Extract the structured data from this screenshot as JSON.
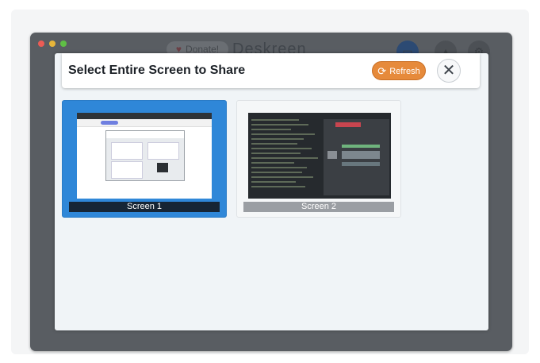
{
  "background_app": {
    "donate_label": "Donate!",
    "app_name": "Deskreen"
  },
  "dialog": {
    "title": "Select Entire Screen to Share",
    "refresh_label": "Refresh",
    "close_symbol": "✕"
  },
  "screens": [
    {
      "label": "Screen 1",
      "selected": true
    },
    {
      "label": "Screen 2",
      "selected": false
    }
  ],
  "icons": {
    "refresh": "refresh-icon",
    "close": "close-icon",
    "heart": "heart-icon"
  },
  "colors": {
    "accent_selected": "#2f87d8",
    "refresh_button": "#e68a3b",
    "window_chrome": "#595d62"
  }
}
